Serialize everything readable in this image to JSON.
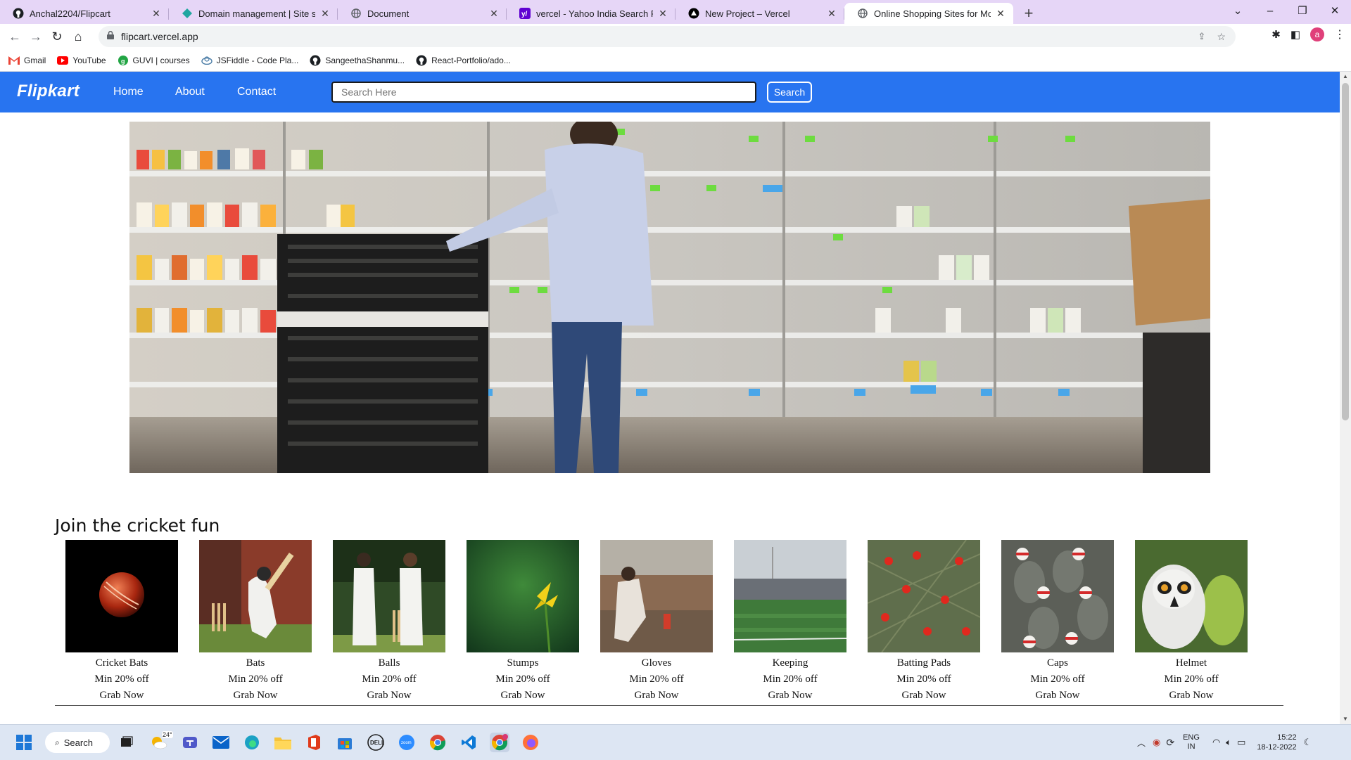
{
  "browser": {
    "tabs": [
      {
        "title": "Anchal2204/Flipcart",
        "icon": "github-icon",
        "active": false
      },
      {
        "title": "Domain management | Site settin",
        "icon": "netlify-icon",
        "active": false
      },
      {
        "title": "Document",
        "icon": "globe-icon",
        "active": false
      },
      {
        "title": "vercel - Yahoo India Search Resul",
        "icon": "yahoo-icon",
        "active": false
      },
      {
        "title": "New Project – Vercel",
        "icon": "vercel-icon",
        "active": false
      },
      {
        "title": "Online Shopping Sites for Mobile",
        "icon": "globe-icon",
        "active": true
      }
    ],
    "new_tab": "+",
    "url": "flipcart.vercel.app",
    "profile_initial": "a",
    "bookmarks": [
      {
        "label": "Gmail",
        "icon": "gmail-icon"
      },
      {
        "label": "YouTube",
        "icon": "youtube-icon"
      },
      {
        "label": "GUVI | courses",
        "icon": "guvi-icon"
      },
      {
        "label": "JSFiddle - Code Pla...",
        "icon": "jsfiddle-icon"
      },
      {
        "label": "SangeethaShanmu...",
        "icon": "github-icon"
      },
      {
        "label": "React-Portfolio/ado...",
        "icon": "github-icon"
      }
    ]
  },
  "site": {
    "brand": "Flipkart",
    "nav": {
      "home": "Home",
      "about": "About",
      "contact": "Contact"
    },
    "search": {
      "placeholder": "Search Here",
      "button": "Search"
    },
    "section_title": "Join the cricket fun",
    "products": [
      {
        "name": "Cricket Bats",
        "offer": "Min 20% off",
        "cta": "Grab Now",
        "image": "cricket-ball-photo"
      },
      {
        "name": "Bats",
        "offer": "Min 20% off",
        "cta": "Grab Now",
        "image": "batsman-photo"
      },
      {
        "name": "Balls",
        "offer": "Min 20% off",
        "cta": "Grab Now",
        "image": "cricketers-photo"
      },
      {
        "name": "Stumps",
        "offer": "Min 20% off",
        "cta": "Grab Now",
        "image": "yellow-flower-photo"
      },
      {
        "name": "Gloves",
        "offer": "Min 20% off",
        "cta": "Grab Now",
        "image": "kids-playing-photo"
      },
      {
        "name": "Keeping",
        "offer": "Min 20% off",
        "cta": "Grab Now",
        "image": "stadium-photo"
      },
      {
        "name": "Batting Pads",
        "offer": "Min 20% off",
        "cta": "Grab Now",
        "image": "red-flowers-photo"
      },
      {
        "name": "Caps",
        "offer": "Min 20% off",
        "cta": "Grab Now",
        "image": "statues-caps-photo"
      },
      {
        "name": "Helmet",
        "offer": "Min 20% off",
        "cta": "Grab Now",
        "image": "lemur-photo"
      }
    ]
  },
  "taskbar": {
    "search_label": "Search",
    "weather": "24°",
    "language": "ENG",
    "region": "IN",
    "time": "15:22",
    "date": "18-12-2022"
  },
  "colors": {
    "navbar": "#2874f0",
    "tabstrip": "#e6d6f7",
    "taskbar": "#dde6f3"
  }
}
